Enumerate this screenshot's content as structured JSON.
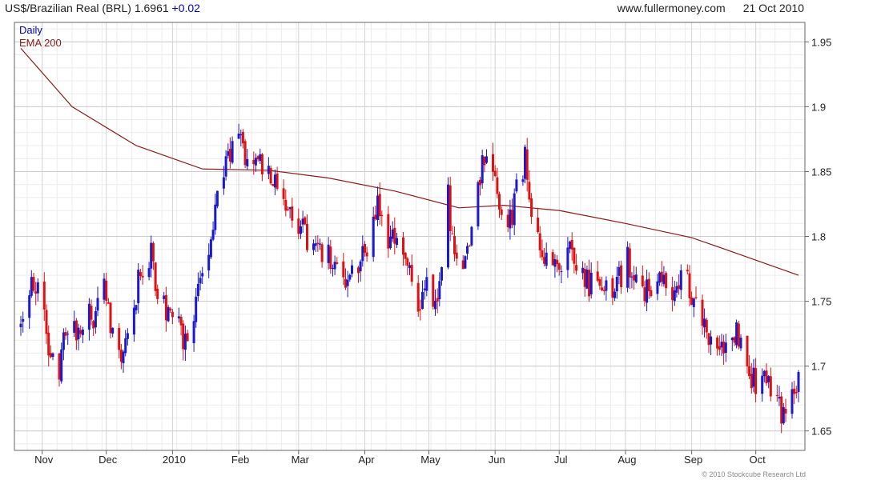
{
  "header": {
    "title": "US$/Brazilian Real (BRL) 1.6961",
    "change": "+0.02",
    "site": "www.fullermoney.com",
    "date": "21 Oct 2010"
  },
  "legend": {
    "daily": "Daily",
    "ema": "EMA 200"
  },
  "copyright": "© 2010 Stockcube Research Ltd",
  "colors": {
    "up": "#1a1acc",
    "down": "#dd1111",
    "ema": "#8b1a1a",
    "grid": "#cccccc"
  },
  "chart_data": {
    "type": "candlestick",
    "title": "US$/Brazilian Real (BRL) 1.6961",
    "ylim": [
      1.635,
      1.965
    ],
    "yticks": [
      1.65,
      1.7,
      1.75,
      1.8,
      1.85,
      1.9,
      1.95
    ],
    "ytick_labels": [
      "1.65",
      "1.7",
      "1.75",
      "1.8",
      "1.85",
      "1.9",
      "1.95"
    ],
    "xticks": [
      "Nov",
      "Dec",
      "2010",
      "Feb",
      "Mar",
      "Apr",
      "May",
      "Jun",
      "Jul",
      "Aug",
      "Sep",
      "Oct"
    ],
    "xtick_dates": [
      "2009-11-01",
      "2009-12-01",
      "2010-01-01",
      "2010-02-01",
      "2010-03-01",
      "2010-04-01",
      "2010-05-01",
      "2010-06-01",
      "2010-07-01",
      "2010-08-01",
      "2010-09-01",
      "2010-10-01"
    ],
    "date_range": [
      "2009-10-22",
      "2010-10-21"
    ],
    "series": [
      {
        "name": "Daily",
        "style": "candlestick",
        "anchors": [
          [
            "2009-10-22",
            1.73
          ],
          [
            "2009-10-27",
            1.77
          ],
          [
            "2009-10-30",
            1.76
          ],
          [
            "2009-11-04",
            1.72
          ],
          [
            "2009-11-09",
            1.7
          ],
          [
            "2009-11-13",
            1.73
          ],
          [
            "2009-11-19",
            1.73
          ],
          [
            "2009-11-25",
            1.74
          ],
          [
            "2009-11-30",
            1.76
          ],
          [
            "2009-12-04",
            1.72
          ],
          [
            "2009-12-08",
            1.71
          ],
          [
            "2009-12-12",
            1.74
          ],
          [
            "2009-12-17",
            1.77
          ],
          [
            "2009-12-22",
            1.79
          ],
          [
            "2009-12-25",
            1.75
          ],
          [
            "2009-12-30",
            1.74
          ],
          [
            "2010-01-04",
            1.73
          ],
          [
            "2010-01-08",
            1.72
          ],
          [
            "2010-01-12",
            1.75
          ],
          [
            "2010-01-17",
            1.78
          ],
          [
            "2010-01-21",
            1.82
          ],
          [
            "2010-01-26",
            1.86
          ],
          [
            "2010-02-01",
            1.88
          ],
          [
            "2010-02-05",
            1.86
          ],
          [
            "2010-02-09",
            1.87
          ],
          [
            "2010-02-13",
            1.85
          ],
          [
            "2010-02-18",
            1.85
          ],
          [
            "2010-02-23",
            1.83
          ],
          [
            "2010-02-27",
            1.81
          ],
          [
            "2010-03-04",
            1.8
          ],
          [
            "2010-03-10",
            1.79
          ],
          [
            "2010-03-17",
            1.78
          ],
          [
            "2010-03-24",
            1.76
          ],
          [
            "2010-03-29",
            1.78
          ],
          [
            "2010-04-02",
            1.79
          ],
          [
            "2010-04-07",
            1.82
          ],
          [
            "2010-04-11",
            1.8
          ],
          [
            "2010-04-16",
            1.79
          ],
          [
            "2010-04-21",
            1.77
          ],
          [
            "2010-04-26",
            1.75
          ],
          [
            "2010-04-30",
            1.76
          ],
          [
            "2010-05-05",
            1.74
          ],
          [
            "2010-05-07",
            1.78
          ],
          [
            "2010-05-09",
            1.85
          ],
          [
            "2010-05-12",
            1.79
          ],
          [
            "2010-05-16",
            1.77
          ],
          [
            "2010-05-20",
            1.8
          ],
          [
            "2010-05-25",
            1.85
          ],
          [
            "2010-05-29",
            1.86
          ],
          [
            "2010-06-03",
            1.82
          ],
          [
            "2010-06-07",
            1.8
          ],
          [
            "2010-06-11",
            1.84
          ],
          [
            "2010-06-15",
            1.86
          ],
          [
            "2010-06-19",
            1.81
          ],
          [
            "2010-06-23",
            1.79
          ],
          [
            "2010-06-27",
            1.77
          ],
          [
            "2010-07-01",
            1.78
          ],
          [
            "2010-07-05",
            1.8
          ],
          [
            "2010-07-09",
            1.78
          ],
          [
            "2010-07-13",
            1.76
          ],
          [
            "2010-07-17",
            1.77
          ],
          [
            "2010-07-22",
            1.76
          ],
          [
            "2010-07-27",
            1.76
          ],
          [
            "2010-08-02",
            1.78
          ],
          [
            "2010-08-06",
            1.77
          ],
          [
            "2010-08-10",
            1.76
          ],
          [
            "2010-08-14",
            1.76
          ],
          [
            "2010-08-19",
            1.77
          ],
          [
            "2010-08-23",
            1.76
          ],
          [
            "2010-08-27",
            1.77
          ],
          [
            "2010-08-31",
            1.76
          ],
          [
            "2010-09-04",
            1.74
          ],
          [
            "2010-09-08",
            1.72
          ],
          [
            "2010-09-13",
            1.71
          ],
          [
            "2010-09-17",
            1.72
          ],
          [
            "2010-09-21",
            1.73
          ],
          [
            "2010-09-25",
            1.71
          ],
          [
            "2010-09-29",
            1.69
          ],
          [
            "2010-10-03",
            1.68
          ],
          [
            "2010-10-07",
            1.69
          ],
          [
            "2010-10-11",
            1.67
          ],
          [
            "2010-10-14",
            1.66
          ],
          [
            "2010-10-17",
            1.67
          ],
          [
            "2010-10-21",
            1.696
          ]
        ]
      },
      {
        "name": "EMA 200",
        "style": "line",
        "points": [
          [
            "2009-10-22",
            1.945
          ],
          [
            "2009-11-15",
            1.9
          ],
          [
            "2009-12-15",
            1.87
          ],
          [
            "2010-01-15",
            1.852
          ],
          [
            "2010-02-15",
            1.851
          ],
          [
            "2010-03-15",
            1.845
          ],
          [
            "2010-04-15",
            1.835
          ],
          [
            "2010-05-15",
            1.822
          ],
          [
            "2010-06-05",
            1.824
          ],
          [
            "2010-07-01",
            1.82
          ],
          [
            "2010-08-01",
            1.81
          ],
          [
            "2010-09-01",
            1.799
          ],
          [
            "2010-09-15",
            1.791
          ],
          [
            "2010-10-21",
            1.77
          ]
        ]
      }
    ]
  }
}
